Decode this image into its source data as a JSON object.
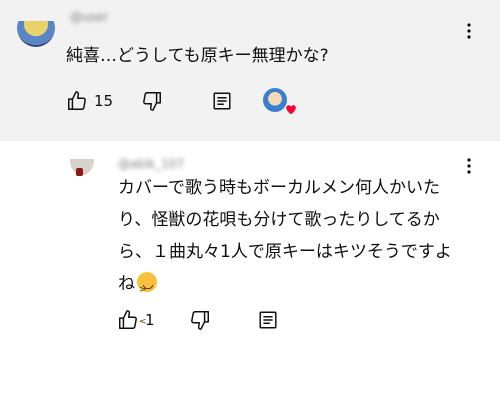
{
  "comments": [
    {
      "handle": "@user",
      "text": "純喜…どうしても原キー無理かな?",
      "likes": "15"
    },
    {
      "handle": "@abik_107",
      "text": "カバーで歌う時もボーカルメン何人かいたり、怪獣の花唄も分けて歌ったりしてるから、１曲丸々1人で原キーはキツそうですよね",
      "likes": "1"
    }
  ],
  "icons": {
    "more": "more-vertical-icon",
    "like": "thumbs-up-icon",
    "dislike": "thumbs-down-icon",
    "reply": "reply-icon",
    "heart": "heart-icon",
    "emoji": "persevering-face-emoji"
  },
  "colors": {
    "highlighted_background": "#f2f2f2",
    "heart": "#ff0033"
  }
}
